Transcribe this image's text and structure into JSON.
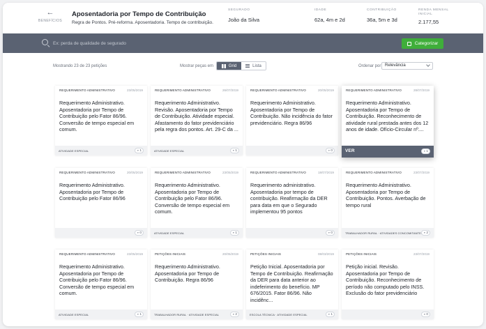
{
  "header": {
    "back_label": "BENEFÍCIOS",
    "title": "Aposentadoria por Tempo de Contribuição",
    "subtitle": "Regra de Pontos. Pré-reforma. Aposentadoria. Tempo de contribuição.",
    "meta": [
      {
        "label": "SEGURADO",
        "value": "João da Silva"
      },
      {
        "label": "IDADE",
        "value": "62a, 4m e 2d"
      },
      {
        "label": "CONTRIBUIÇÃO",
        "value": "36a, 5m e 3d"
      },
      {
        "label": "RENDA MENSAL INICIAL",
        "value": "2.177,55"
      }
    ]
  },
  "search": {
    "placeholder": "Ex: perda de qualidade de segurado",
    "categorize_label": "Categorizar"
  },
  "toolbar": {
    "showing": "Mostrando 23 de 23 petições",
    "view_label": "Mostrar peças em",
    "grid_label": "Grid",
    "list_label": "Lista",
    "sort_label": "Ordenar por",
    "sort_value": "Relevância"
  },
  "cards": [
    {
      "type": "REQUERIMENTO ADMINISTRATIVO",
      "date": "23/05/2019",
      "body": "Requerimento Administrativo. Aposentadoria por Tempo de Contribuição pelo Fator 86/96. Conversão de tempo especial em comum.",
      "tag": "ATIVIDADE ESPECIAL",
      "count": "1"
    },
    {
      "type": "REQUERIMENTO ADMINISTRATIVO",
      "date": "26/07/2019",
      "body": "Requerimento Administrativo. Revisão. Aposentadoria por Tempo de Contribuição. Atividade especial. Afastamento do fator previdenciário pela regra dos pontos. Art. 29-C da ...",
      "tag": "ATIVIDADE ESPECIAL",
      "count": "1"
    },
    {
      "type": "REQUERIMENTO ADMINISTRATIVO",
      "date": "20/05/2019",
      "body": "Requerimento Administrativo. Aposentadoria por Tempo de Contribuição. Não incidência do fator previdenciário. Regra 86/96",
      "tag": "",
      "count": "0"
    },
    {
      "type": "REQUERIMENTO ADMINISTRATIVO",
      "date": "28/07/2019",
      "body": "Requerimento Administrativo. Aposentadoria por Tempo de Contribuição. Reconhecimento de atividade rural prestada antes dos 12 anos de idade. Ofício-Circular nº....",
      "tag": "VER",
      "count": "1"
    },
    {
      "type": "REQUERIMENTO ADMINISTRATIVO",
      "date": "20/05/2019",
      "body": "Requerimento Administrativo. Aposentadoria por Tempo de Contribuição pelo Fator 86/96",
      "tag": "",
      "count": "0"
    },
    {
      "type": "REQUERIMENTO ADMINISTRATIVO",
      "date": "23/05/2019",
      "body": "Requerimento Administrativo. Aposentadoria por Tempo de Contribuição pelo Fator 86/96. Conversão de tempo especial em comum.",
      "tag": "ATIVIDADE ESPECIAL",
      "count": "1"
    },
    {
      "type": "REQUERIMENTO ADMINISTRATIVO",
      "date": "18/07/2019",
      "body": "Requerimento administrativo. Aposentadoria por tempo de contribuição. Reafirmação da DER para data em que o Segurado implementou 95 pontos",
      "tag": "",
      "count": "0"
    },
    {
      "type": "REQUERIMENTO ADMINISTRATIVO",
      "date": "23/07/2019",
      "body": "Requerimento Administrativo. Aposentadoria por Tempo de Contribuição. Pontos. Averbação de tempo rural",
      "tag": "TRABALHADOR RURAL · ATIVIDADES CONCOMITANTES",
      "count": "2"
    },
    {
      "type": "REQUERIMENTO ADMINISTRATIVO",
      "date": "23/05/2019",
      "body": "Requerimento Administrativo. Aposentadoria por Tempo de Contribuição pelo Fator 86/96. Conversão de tempo especial em comum.",
      "tag": "ATIVIDADE ESPECIAL",
      "count": "1"
    },
    {
      "type": "PETIÇÕES INICIAIS",
      "date": "20/05/2019",
      "body": "Requerimento Administrativo. Aposentadoria por Tempo de Contribuição. Regra 86/96",
      "tag": "TRABALHADOR RURAL · ATIVIDADE ESPECIAL",
      "count": "2"
    },
    {
      "type": "PETIÇÕES INICIAIS",
      "date": "08/03/2019",
      "body": "Petição Inicial. Aposentadoria por Tempo de Contribuição. Reafirmação da DER para data anterior ao indeferimento do benefício. MP 676/2015. Fator 86/96. Não incidênc...",
      "tag": "ESCOLA TÉCNICA · ATIVIDADE ESPECIAL",
      "count": "1"
    },
    {
      "type": "PETIÇÕES INICIAIS",
      "date": "23/07/2019",
      "body": "Petição inicial. Revisão. Aposentadoria por Tempo de Contribuição. Reconhecimento de período não computado pelo INSS. Exclusão do fator previdenciário",
      "tag": "",
      "count": "0"
    }
  ]
}
